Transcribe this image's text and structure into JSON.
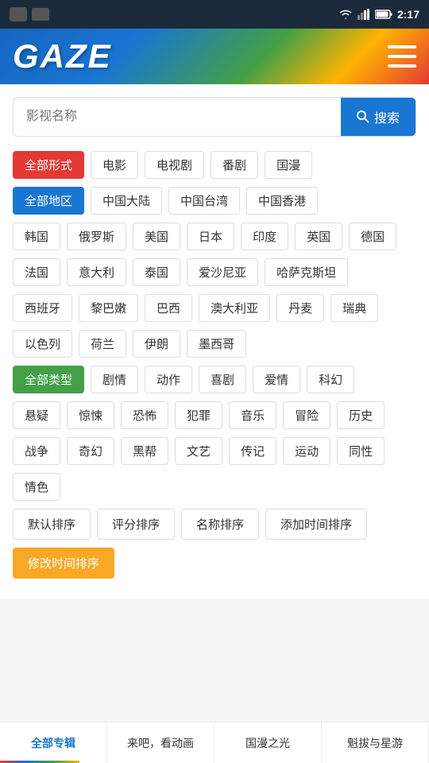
{
  "statusBar": {
    "time": "2:17"
  },
  "header": {
    "logo": "GAZE",
    "menuLabel": "菜单"
  },
  "search": {
    "placeholder": "影视名称",
    "buttonLabel": "搜索"
  },
  "filterSections": {
    "format": {
      "tags": [
        {
          "label": "全部形式",
          "active": "red"
        },
        {
          "label": "电影"
        },
        {
          "label": "电视剧"
        },
        {
          "label": "番剧"
        },
        {
          "label": "国漫"
        }
      ]
    },
    "region": {
      "tags": [
        {
          "label": "全部地区",
          "active": "blue"
        },
        {
          "label": "中国大陆"
        },
        {
          "label": "中国台湾"
        },
        {
          "label": "中国香港"
        }
      ]
    },
    "region2": {
      "tags": [
        {
          "label": "韩国"
        },
        {
          "label": "俄罗斯"
        },
        {
          "label": "美国"
        },
        {
          "label": "日本"
        },
        {
          "label": "印度"
        },
        {
          "label": "英国"
        },
        {
          "label": "德国"
        }
      ]
    },
    "region3": {
      "tags": [
        {
          "label": "法国"
        },
        {
          "label": "意大利"
        },
        {
          "label": "泰国"
        },
        {
          "label": "爱沙尼亚"
        },
        {
          "label": "哈萨克斯坦"
        }
      ]
    },
    "region4": {
      "tags": [
        {
          "label": "西班牙"
        },
        {
          "label": "黎巴嫩"
        },
        {
          "label": "巴西"
        },
        {
          "label": "澳大利亚"
        },
        {
          "label": "丹麦"
        },
        {
          "label": "瑞典"
        }
      ]
    },
    "region5": {
      "tags": [
        {
          "label": "以色列"
        },
        {
          "label": "荷兰"
        },
        {
          "label": "伊朗"
        },
        {
          "label": "墨西哥"
        }
      ]
    },
    "genre": {
      "tags": [
        {
          "label": "全部类型",
          "active": "green"
        },
        {
          "label": "剧情"
        },
        {
          "label": "动作"
        },
        {
          "label": "喜剧"
        },
        {
          "label": "爱情"
        },
        {
          "label": "科幻"
        }
      ]
    },
    "genre2": {
      "tags": [
        {
          "label": "悬疑"
        },
        {
          "label": "惊悚"
        },
        {
          "label": "恐怖"
        },
        {
          "label": "犯罪"
        },
        {
          "label": "音乐"
        },
        {
          "label": "冒险"
        },
        {
          "label": "历史"
        }
      ]
    },
    "genre3": {
      "tags": [
        {
          "label": "战争"
        },
        {
          "label": "奇幻"
        },
        {
          "label": "黑帮"
        },
        {
          "label": "文艺"
        },
        {
          "label": "传记"
        },
        {
          "label": "运动"
        },
        {
          "label": "同性"
        }
      ]
    },
    "genre4": {
      "tags": [
        {
          "label": "情色"
        }
      ]
    }
  },
  "sortSection": {
    "buttons": [
      {
        "label": "默认排序"
      },
      {
        "label": "评分排序"
      },
      {
        "label": "名称排序"
      },
      {
        "label": "添加时间排序"
      }
    ],
    "activeButton": {
      "label": "修改时间排序",
      "active": "yellow"
    }
  },
  "bottomTabs": {
    "tabs": [
      {
        "label": "全部专辑",
        "active": true
      },
      {
        "label": "来吧，看动画"
      },
      {
        "label": "国漫之光"
      },
      {
        "label": "魁拔与星游"
      }
    ]
  }
}
